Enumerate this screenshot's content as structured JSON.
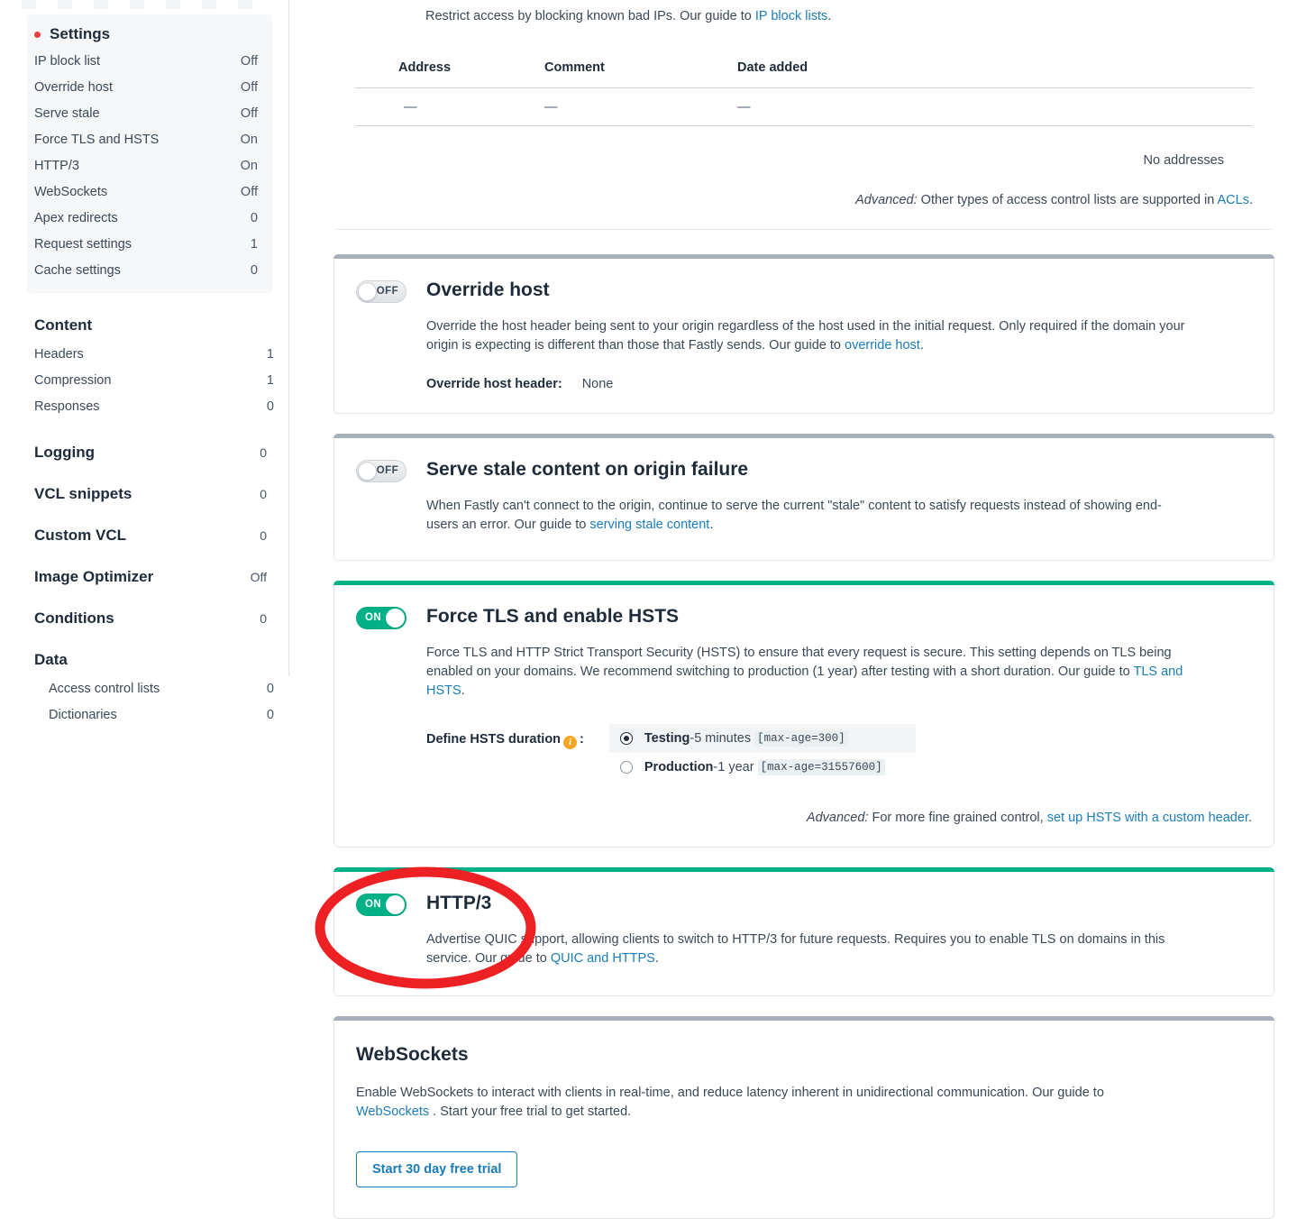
{
  "sidebar": {
    "settings_group": {
      "title": "Settings",
      "items": [
        {
          "label": "IP block list",
          "value": "Off"
        },
        {
          "label": "Override host",
          "value": "Off"
        },
        {
          "label": "Serve stale",
          "value": "Off"
        },
        {
          "label": "Force TLS and HSTS",
          "value": "On"
        },
        {
          "label": "HTTP/3",
          "value": "On"
        },
        {
          "label": "WebSockets",
          "value": "Off"
        },
        {
          "label": "Apex redirects",
          "value": "0"
        },
        {
          "label": "Request settings",
          "value": "1"
        },
        {
          "label": "Cache settings",
          "value": "0"
        }
      ]
    },
    "content_group": {
      "title": "Content",
      "value": "",
      "items": [
        {
          "label": "Headers",
          "value": "1"
        },
        {
          "label": "Compression",
          "value": "1"
        },
        {
          "label": "Responses",
          "value": "0"
        }
      ]
    },
    "standalone": [
      {
        "label": "Logging",
        "value": "0"
      },
      {
        "label": "VCL snippets",
        "value": "0"
      },
      {
        "label": "Custom VCL",
        "value": "0"
      },
      {
        "label": "Image Optimizer",
        "value": "Off"
      },
      {
        "label": "Conditions",
        "value": "0"
      }
    ],
    "data_group": {
      "title": "Data",
      "items": [
        {
          "label": "Access control lists",
          "value": "0"
        },
        {
          "label": "Dictionaries",
          "value": "0"
        }
      ]
    }
  },
  "ip_block_list": {
    "desc_before": "Restrict access by blocking known bad IPs. Our guide to ",
    "desc_link": "IP block lists",
    "desc_after": ".",
    "columns": [
      "Address",
      "Comment",
      "Date added"
    ],
    "rows": [
      [
        "—",
        "—",
        "—"
      ]
    ],
    "empty_text": "No addresses",
    "advanced_label": "Advanced:",
    "advanced_text": " Other types of access control lists are supported in ",
    "advanced_link": "ACLs",
    "advanced_after": "."
  },
  "override_host": {
    "toggle_state": "OFF",
    "title": "Override host",
    "desc_before": "Override the host header being sent to your origin regardless of the host used in the initial request. Only required if the domain your origin is expecting is different than those that Fastly sends. Our guide to ",
    "desc_link": "override host",
    "desc_after": ".",
    "field_label": "Override host header:",
    "field_value": "None"
  },
  "serve_stale": {
    "toggle_state": "OFF",
    "title": "Serve stale content on origin failure",
    "desc_before": "When Fastly can't connect to the origin, continue to serve the current \"stale\" content to satisfy requests instead of showing end-users an error. Our guide to ",
    "desc_link": "serving stale content",
    "desc_after": "."
  },
  "force_tls": {
    "toggle_state": "ON",
    "title": "Force TLS and enable HSTS",
    "desc_before": "Force TLS and HTTP Strict Transport Security (HSTS) to ensure that every request is secure. This setting depends on TLS being enabled on your domains. We recommend switching to production (1 year) after testing with a short duration. Our guide to ",
    "desc_link": "TLS and HSTS",
    "desc_after": ".",
    "duration_label": "Define HSTS duration",
    "duration_colon": ":",
    "info_glyph": "i",
    "options": [
      {
        "name": "Testing",
        "sep": " - ",
        "detail": "5 minutes",
        "code": "[max-age=300]",
        "selected": true
      },
      {
        "name": "Production",
        "sep": " - ",
        "detail": "1 year",
        "code": "[max-age=31557600]",
        "selected": false
      }
    ],
    "advanced_label": "Advanced:",
    "advanced_text": " For more fine grained control, ",
    "advanced_link": "set up HSTS with a custom header",
    "advanced_after": "."
  },
  "http3": {
    "toggle_state": "ON",
    "title": "HTTP/3",
    "desc_before": "Advertise QUIC support, allowing clients to switch to HTTP/3 for future requests. Requires you to enable TLS on domains in this service. Our guide to ",
    "desc_link": "QUIC and HTTPS",
    "desc_after": "."
  },
  "websockets": {
    "title": "WebSockets",
    "desc_before": "Enable WebSockets to interact with clients in real-time, and reduce latency inherent in unidirectional communication. Our guide to ",
    "desc_link": "WebSockets",
    "desc_after": " . Start your free trial to get started.",
    "button_label": "Start 30 day free trial"
  },
  "annotation": {
    "shape": "ellipse-highlight",
    "color": "#ED2024"
  },
  "colors": {
    "accent_green": "#00b188",
    "link_blue": "#1a7cb8",
    "annotation_red": "#ED2024",
    "card_border_grey": "#a7b0ba",
    "info_orange": "#f5a623",
    "bullet_red": "#e8413a"
  }
}
